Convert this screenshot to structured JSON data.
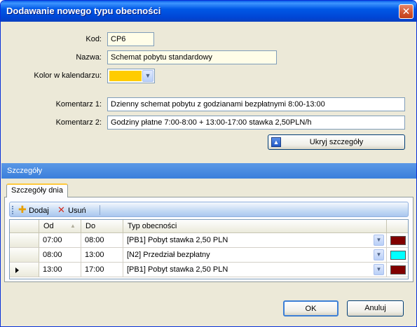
{
  "window": {
    "title": "Dodawanie nowego typu  obecności"
  },
  "form": {
    "kod_label": "Kod:",
    "kod_value": "CP6",
    "nazwa_label": "Nazwa:",
    "nazwa_value": "Schemat pobytu standardowy",
    "kolor_label": "Kolor w kalendarzu:",
    "kolor_value": "#ffcc00",
    "komentarz1_label": "Komentarz 1:",
    "komentarz1_value": "Dzienny schemat pobytu z godzianami bezpłatnymi 8:00-13:00",
    "komentarz2_label": "Komentarz 2:",
    "komentarz2_value": "Godziny płatne 7:00-8:00 + 13:00-17:00 stawka 2,50PLN/h",
    "hide_details_label": "Ukryj szczegóły"
  },
  "details": {
    "section_title": "Szczegóły",
    "tab_label": "Szczegóły dnia",
    "toolbar": {
      "add_label": "Dodaj",
      "remove_label": "Usuń"
    },
    "columns": {
      "od": "Od",
      "do": "Do",
      "typ": "Typ obecności"
    },
    "rows": [
      {
        "od": "07:00",
        "do": "08:00",
        "typ": "[PB1]  Pobyt stawka 2,50 PLN",
        "color": "#800000",
        "current": false
      },
      {
        "od": "08:00",
        "do": "13:00",
        "typ": "[N2]  Przedział bezpłatny",
        "color": "#00ffff",
        "current": false
      },
      {
        "od": "13:00",
        "do": "17:00",
        "typ": "[PB1]  Pobyt stawka 2,50 PLN",
        "color": "#800000",
        "current": true
      }
    ]
  },
  "buttons": {
    "ok": "OK",
    "cancel": "Anuluj"
  },
  "colors": {
    "title_bar": "#0058e6",
    "section_bar": "#3b7fdb",
    "field_bg": "#fffde8"
  }
}
